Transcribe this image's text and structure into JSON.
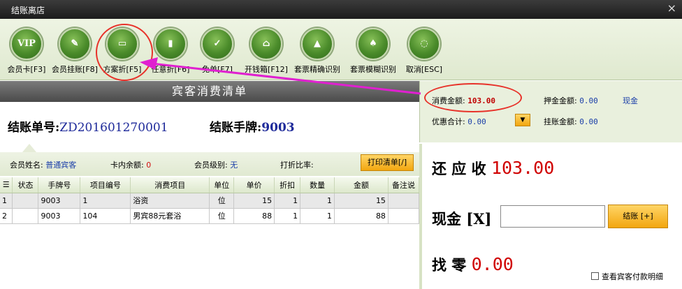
{
  "window": {
    "title": "结账离店",
    "close_glyph": "×"
  },
  "toolbar": [
    {
      "label": "会员卡[F3]",
      "icon": "vip-card-icon",
      "glyph": "VIP"
    },
    {
      "label": "会员挂账[F8]",
      "icon": "member-credit-icon",
      "glyph": "✎"
    },
    {
      "label": "方案折[F5]",
      "icon": "plan-discount-icon",
      "glyph": "▭"
    },
    {
      "label": "任意折[F6]",
      "icon": "any-discount-icon",
      "glyph": "▮"
    },
    {
      "label": "免单[F7]",
      "icon": "free-bill-icon",
      "glyph": "✓"
    },
    {
      "label": "开钱箱[F12]",
      "icon": "cash-drawer-icon",
      "glyph": "⌂"
    },
    {
      "label": "套票精确识别",
      "icon": "ticket-exact-icon",
      "glyph": "▲"
    },
    {
      "label": "套票模糊识别",
      "icon": "ticket-fuzzy-icon",
      "glyph": "♠"
    },
    {
      "label": "取消[ESC]",
      "icon": "cancel-icon",
      "glyph": "◌"
    }
  ],
  "bill": {
    "header": "宾客消费清单",
    "number_label": "结账单号:",
    "number_value": "ZD201601270001",
    "plate_label": "结账手牌:",
    "plate_value": "9003"
  },
  "member": {
    "name_label": "会员姓名:",
    "name_value": "普通宾客",
    "balance_label": "卡内余额:",
    "balance_value": "0",
    "level_label": "会员级别:",
    "level_value": "无",
    "discount_label": "打折比率:",
    "discount_value": "",
    "print_button": "打印清单[/]"
  },
  "table": {
    "headers": [
      "☰",
      "状态",
      "手牌号",
      "项目编号",
      "消费项目",
      "单位",
      "单价",
      "折扣",
      "数量",
      "金额",
      "备注说"
    ],
    "rows": [
      [
        "1",
        "",
        "9003",
        "1",
        "浴资",
        "位",
        "15",
        "1",
        "1",
        "15",
        ""
      ],
      [
        "2",
        "",
        "9003",
        "104",
        "男宾88元套浴",
        "位",
        "88",
        "1",
        "1",
        "88",
        ""
      ]
    ]
  },
  "summary": {
    "consume_label": "消费金额:",
    "consume_value": "103.00",
    "deposit_label": "押金金额:",
    "deposit_value": "0.00",
    "deposit_type": "现金",
    "discount_total_label": "优惠合计:",
    "discount_total_value": "0.00",
    "credit_label": "挂账金额:",
    "credit_value": "0.00",
    "due_label": "还 应 收",
    "due_value": "103.00",
    "cash_label": "现金 [X]",
    "cash_value": "",
    "pay_button": "结账 [+]",
    "change_label": "找    零",
    "change_value": "0.00",
    "detail_checkbox": "查看宾客付款明细"
  },
  "colors": {
    "accent_red": "#e8322a",
    "arrow": "#e020d0",
    "value_blue": "#1a3ea8",
    "amount_red": "#d00000"
  }
}
